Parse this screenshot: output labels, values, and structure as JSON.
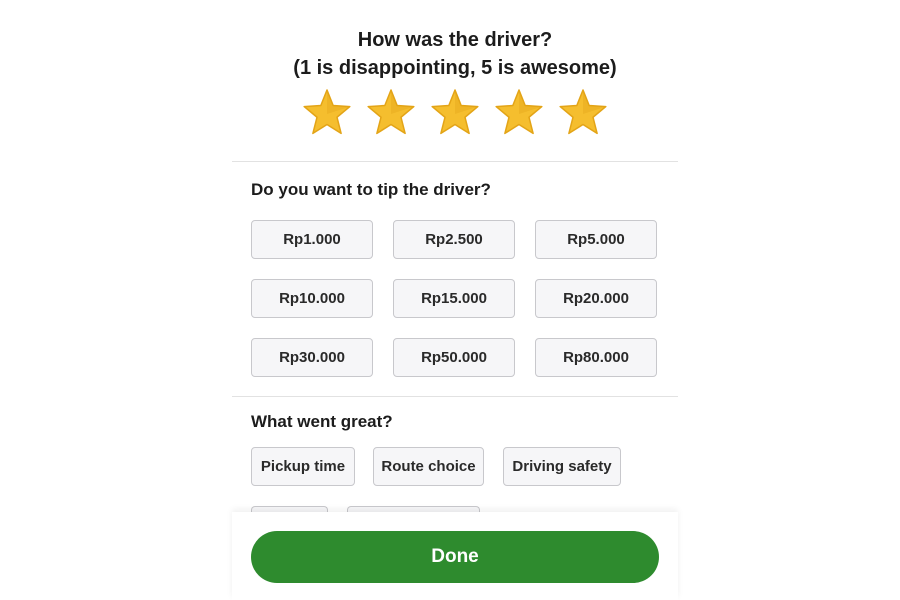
{
  "rating": {
    "title_line1": "How was the driver?",
    "title_line2": "(1 is disappointing, 5 is awesome)",
    "stars_filled": 5,
    "stars_total": 5,
    "star_color": "#F5BE2E",
    "star_shade": "#E3A417"
  },
  "tip": {
    "title": "Do you want to tip the driver?",
    "options": [
      "Rp1.000",
      "Rp2.500",
      "Rp5.000",
      "Rp10.000",
      "Rp15.000",
      "Rp20.000",
      "Rp30.000",
      "Rp50.000",
      "Rp80.000"
    ]
  },
  "feedback": {
    "title": "What went great?",
    "chips": [
      "Pickup time",
      "Route choice",
      "Driving safety"
    ]
  },
  "footer": {
    "done_label": "Done",
    "done_color": "#2E8B2E"
  }
}
